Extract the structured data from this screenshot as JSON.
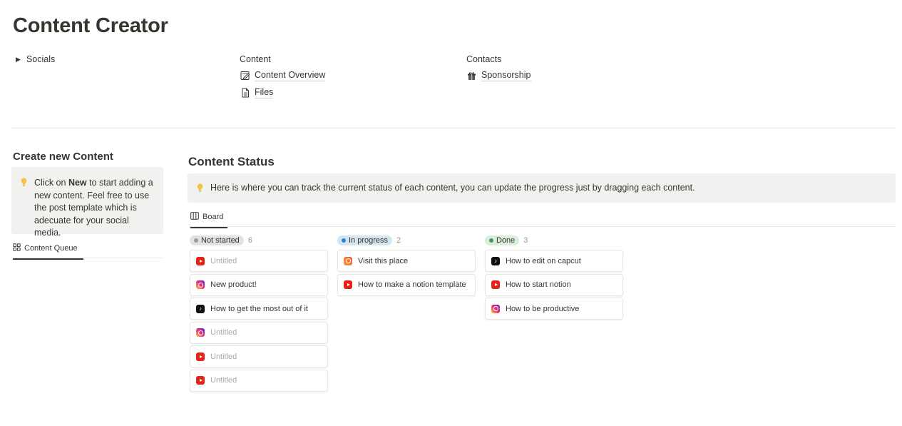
{
  "page": {
    "title": "Content Creator"
  },
  "links": {
    "socials": {
      "label": "Socials"
    },
    "content": {
      "heading": "Content",
      "items": [
        {
          "label": "Content Overview",
          "icon": "edit-note-icon"
        },
        {
          "label": "Files",
          "icon": "document-icon"
        }
      ]
    },
    "contacts": {
      "heading": "Contacts",
      "items": [
        {
          "label": "Sponsorship",
          "icon": "gift-icon"
        }
      ]
    }
  },
  "sidebar": {
    "title": "Create new Content",
    "callout": {
      "prefix": "Click on ",
      "bold": "New",
      "suffix": " to start adding a new content. Feel free to use the post template which is adecuate for your social media."
    },
    "tab": {
      "label": "Content Queue",
      "icon": "gallery-icon"
    }
  },
  "main": {
    "title": "Content Status",
    "callout": "Here is where you can track the current status of each content, you can update the progress just by dragging each content.",
    "tab": {
      "label": "Board",
      "icon": "board-icon"
    },
    "columns": [
      {
        "status": "Not started",
        "count": "6",
        "pill_bg": "#e3e2e0",
        "dot": "#9b9a97",
        "cards": [
          {
            "title": "Untitled",
            "platform": "youtube",
            "muted": true
          },
          {
            "title": "New product!",
            "platform": "instagram",
            "muted": false
          },
          {
            "title": "How to get the most out of it",
            "platform": "tiktok",
            "muted": false
          },
          {
            "title": "Untitled",
            "platform": "instagram",
            "muted": true
          },
          {
            "title": "Untitled",
            "platform": "youtube",
            "muted": true
          },
          {
            "title": "Untitled",
            "platform": "youtube",
            "muted": true
          }
        ]
      },
      {
        "status": "In progress",
        "count": "2",
        "pill_bg": "#d3e5ef",
        "dot": "#2f84c9",
        "cards": [
          {
            "title": "Visit this place",
            "platform": "instagram-orange",
            "muted": false
          },
          {
            "title": "How to make a notion template",
            "platform": "youtube",
            "muted": false
          }
        ]
      },
      {
        "status": "Done",
        "count": "3",
        "pill_bg": "#dbeddb",
        "dot": "#4a9a5b",
        "cards": [
          {
            "title": "How to edit on capcut",
            "platform": "tiktok",
            "muted": false
          },
          {
            "title": "How to start notion",
            "platform": "youtube",
            "muted": false
          },
          {
            "title": "How to be productive",
            "platform": "instagram",
            "muted": false
          }
        ]
      }
    ]
  },
  "colors": {
    "text": "#37352f",
    "muted": "#a9a8a4",
    "callout_bg": "#f1f1ef",
    "bulb": "#f5c242"
  }
}
